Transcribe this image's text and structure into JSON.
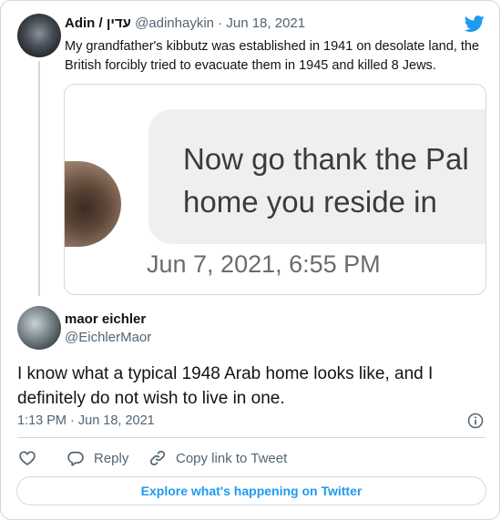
{
  "parent_tweet": {
    "author_name": "Adin / עדין",
    "author_handle": "@adinhaykin",
    "separator": "·",
    "date": "Jun 18, 2021",
    "text": "My grandfather's kibbutz was established in 1941 on desolate land, the British forcibly tried to evacuate them in 1945 and killed 8 Jews.",
    "embedded_image": {
      "message_text": "Now go thank the Pal\nhome you reside in",
      "timestamp": "Jun 7, 2021, 6:55 PM"
    }
  },
  "main_tweet": {
    "author_name": "maor eichler",
    "author_handle": "@EichlerMaor",
    "text": "I know what a typical 1948 Arab home looks like, and I definitely do not wish to live in one.",
    "time": "1:13 PM · Jun 18, 2021"
  },
  "actions": {
    "reply_label": "Reply",
    "copy_label": "Copy link to Tweet"
  },
  "explore_label": "Explore what's happening on Twitter",
  "colors": {
    "accent": "#1d9bf0",
    "muted_text": "#536471",
    "border": "#cfd9de"
  },
  "icons": [
    "twitter-bird-icon",
    "info-icon",
    "heart-icon",
    "reply-icon",
    "link-icon"
  ]
}
